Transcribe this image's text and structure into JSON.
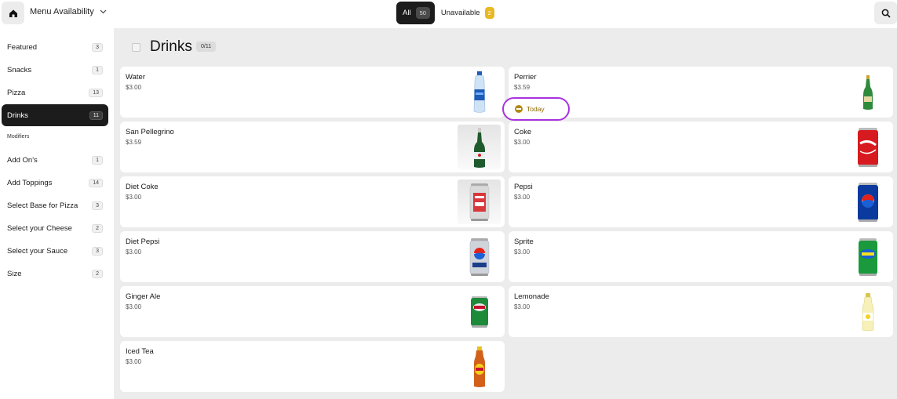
{
  "header": {
    "title": "Menu Availability",
    "filters": [
      {
        "label": "All",
        "count": "50"
      },
      {
        "label": "Unavailable",
        "count": "2"
      }
    ]
  },
  "sidebar": {
    "items": [
      {
        "label": "Featured",
        "count": "3"
      },
      {
        "label": "Snacks",
        "count": "1"
      },
      {
        "label": "Pizza",
        "count": "13"
      },
      {
        "label": "Drinks",
        "count": "11"
      }
    ],
    "modifiers_header": "Modifiers",
    "modifiers": [
      {
        "label": "Add On's",
        "count": "1"
      },
      {
        "label": "Add Toppings",
        "count": "14"
      },
      {
        "label": "Select Base for Pizza",
        "count": "3"
      },
      {
        "label": "Select your Cheese",
        "count": "2"
      },
      {
        "label": "Select your Sauce",
        "count": "3"
      },
      {
        "label": "Size",
        "count": "2"
      }
    ]
  },
  "main": {
    "title": "Drinks",
    "count": "0/11",
    "items": [
      {
        "name": "Water",
        "price": "$3.00",
        "icon": "water-bottle"
      },
      {
        "name": "Perrier",
        "price": "$3.59",
        "icon": "green-bottle",
        "badge": "Today"
      },
      {
        "name": "San Pellegrino",
        "price": "$3.59",
        "icon": "green-bottle"
      },
      {
        "name": "Coke",
        "price": "$3.00",
        "icon": "red-can"
      },
      {
        "name": "Diet Coke",
        "price": "$3.00",
        "icon": "silver-can"
      },
      {
        "name": "Pepsi",
        "price": "$3.00",
        "icon": "blue-can"
      },
      {
        "name": "Diet Pepsi",
        "price": "$3.00",
        "icon": "silver-blue-can"
      },
      {
        "name": "Sprite",
        "price": "$3.00",
        "icon": "green-can"
      },
      {
        "name": "Ginger Ale",
        "price": "$3.00",
        "icon": "green-can"
      },
      {
        "name": "Lemonade",
        "price": "$3.00",
        "icon": "lemonade-bottle"
      },
      {
        "name": "Iced Tea",
        "price": "$3.00",
        "icon": "tea-bottle"
      }
    ]
  },
  "colors": {
    "active": "#1c1c1c",
    "unavailable_badge": "#e8b923",
    "highlight_ring": "#a832e0",
    "today_text": "#8a6a00"
  }
}
